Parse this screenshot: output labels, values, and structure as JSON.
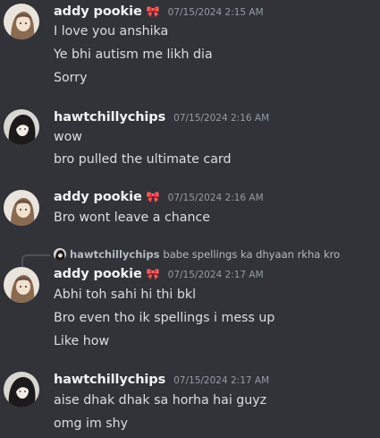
{
  "messages": [
    {
      "author": "addy pookie",
      "bow_icon": "ribbon-icon",
      "timestamp": "07/15/2024 2:15 AM",
      "lines": [
        "I love you anshika",
        "Ye bhi autism me likh dia",
        "Sorry"
      ]
    },
    {
      "author": "hawtchillychips",
      "timestamp": "07/15/2024 2:16 AM",
      "lines": [
        "wow",
        "bro pulled the ultimate card"
      ]
    },
    {
      "author": "addy pookie",
      "bow_icon": "ribbon-icon",
      "timestamp": "07/15/2024 2:16 AM",
      "lines": [
        "Bro wont leave a chance"
      ]
    },
    {
      "reply": {
        "author": "hawtchillychips",
        "text": "babe spellings ka dhyaan rkha kro"
      },
      "author": "addy pookie",
      "bow_icon": "ribbon-icon",
      "timestamp": "07/15/2024 2:17 AM",
      "lines": [
        "Abhi toh sahi hi thi bkl",
        "Bro even tho ik spellings i mess up",
        "Like how"
      ]
    },
    {
      "author": "hawtchillychips",
      "timestamp": "07/15/2024 2:17 AM",
      "lines": [
        "aise dhak dhak sa horha hai guyz",
        "omg im shy"
      ]
    }
  ],
  "colors": {
    "background": "#313338",
    "username": "#f2f3f5",
    "timestamp": "#949ba4",
    "text": "#dbdee1"
  }
}
